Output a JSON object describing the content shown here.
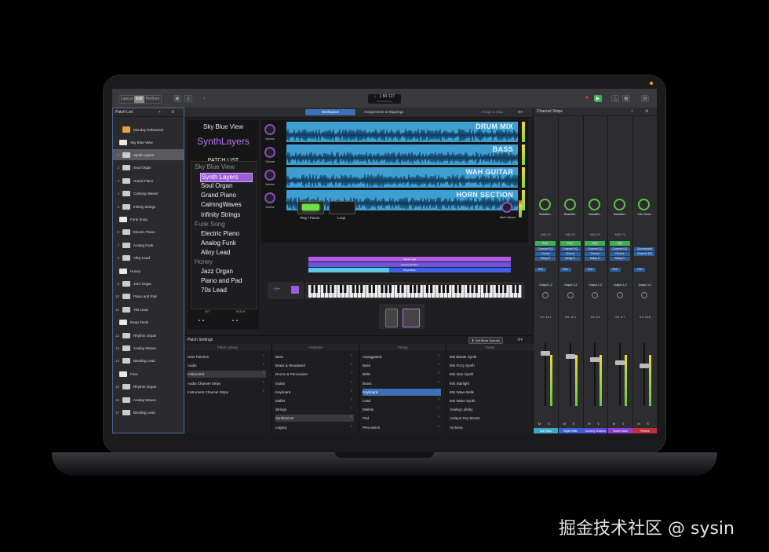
{
  "colors": {
    "accent": "#3c6fb8",
    "purple": "#9c5dd8",
    "green": "#6ee04a"
  },
  "toolbar": {
    "modes": [
      "Layout",
      "Edit",
      "Perform"
    ],
    "active_mode": "Edit",
    "lcd_line1": "♩ 1   84   127",
    "lcd_line2": "bar  tempo  key"
  },
  "patch_list": {
    "title": "Patch List",
    "concert": "Monday Rehearsal",
    "rows": [
      {
        "type": "folder",
        "label": "Sky Blue View"
      },
      {
        "type": "patch",
        "num": "1",
        "label": "Synth Layers",
        "selected": true
      },
      {
        "type": "patch",
        "num": "2",
        "label": "Soul Organ"
      },
      {
        "type": "patch",
        "num": "3",
        "label": "Grand Piano"
      },
      {
        "type": "patch",
        "num": "4",
        "label": "Calming Waves"
      },
      {
        "type": "patch",
        "num": "5",
        "label": "Infinity Strings"
      },
      {
        "type": "folder",
        "label": "Funk Song"
      },
      {
        "type": "patch",
        "num": "6",
        "label": "Electric Piano"
      },
      {
        "type": "patch",
        "num": "7",
        "label": "Analog Funk"
      },
      {
        "type": "patch",
        "num": "8",
        "label": "Alloy Lead"
      },
      {
        "type": "folder",
        "label": "Honey"
      },
      {
        "type": "patch",
        "num": "9",
        "label": "Jazz Organ"
      },
      {
        "type": "patch",
        "num": "10",
        "label": "Piano and Pad"
      },
      {
        "type": "patch",
        "num": "11",
        "label": "70s Lead"
      },
      {
        "type": "folder",
        "label": "Deep Feels"
      },
      {
        "type": "patch",
        "num": "12",
        "label": "Rhythm Organ"
      },
      {
        "type": "patch",
        "num": "13",
        "label": "Analog Waves"
      },
      {
        "type": "patch",
        "num": "14",
        "label": "Bending Lead"
      },
      {
        "type": "folder",
        "label": "Flow"
      },
      {
        "type": "patch",
        "num": "15",
        "label": "Rhythm Organ"
      },
      {
        "type": "patch",
        "num": "16",
        "label": "Analog Waves"
      },
      {
        "type": "patch",
        "num": "17",
        "label": "Bending Lead"
      }
    ]
  },
  "workspace": {
    "tabs": [
      "Workspace",
      "Assignments & Mappings",
      "Assign & Map"
    ],
    "set_name": "Sky Blue View",
    "patch_name": "SynthLayers",
    "list_title": "PATCH LIST",
    "list": [
      {
        "t": "hdr",
        "label": "Sky Blue View"
      },
      {
        "t": "sel",
        "label": "Synth Layers"
      },
      {
        "t": "itm",
        "label": "Soul Organ"
      },
      {
        "t": "itm",
        "label": "Grand Piano"
      },
      {
        "t": "itm",
        "label": "CalmngWaves"
      },
      {
        "t": "itm",
        "label": "Infinity Strings"
      },
      {
        "t": "hdr",
        "label": "Funk Song"
      },
      {
        "t": "itm",
        "label": "Electric Piano"
      },
      {
        "t": "itm",
        "label": "Analog Funk"
      },
      {
        "t": "itm",
        "label": "Alloy Lead"
      },
      {
        "t": "hdr",
        "label": "Honey"
      },
      {
        "t": "itm",
        "label": "Jazz Organ"
      },
      {
        "t": "itm",
        "label": "Piano and Pad"
      },
      {
        "t": "itm",
        "label": "70s Lead"
      }
    ],
    "set_label": "SET",
    "patch_label": "PATCH",
    "knob_label": "Volume",
    "tracks": [
      "DRUM MIX",
      "BASS",
      "WAH GUITAR",
      "HORN SECTION"
    ],
    "play_label": "Play / Pause",
    "loop_label": "Loop",
    "main_volume": "Main Volume",
    "layers": [
      "Sweet Lead",
      "Glowing Shadow",
      "Bright Bells"
    ]
  },
  "channel_strips": {
    "title": "Channel Strips",
    "strips": [
      {
        "setting": "Beautiful...",
        "input": "MIDI FX",
        "eq": "EQ2",
        "fx": [
          "Channel EQ",
          "Chorus",
          "Delay D"
        ],
        "send": "Rvb",
        "output": "Output 1-2",
        "vals": "0.0  -12.1",
        "name": "Sub Bass",
        "color": "#3ba7c9"
      },
      {
        "setting": "Beautiful...",
        "input": "MIDI FX",
        "eq": "EQ2",
        "fx": [
          "Channel EQ",
          "Chorus",
          "Delay D"
        ],
        "send": "Rvb",
        "output": "Output 1-2",
        "vals": "0.0  -12.1",
        "name": "Bright Bells",
        "color": "#3b5fd6"
      },
      {
        "setting": "Beautiful...",
        "input": "MIDI FX",
        "eq": "EQ2",
        "fx": [
          "Channel EQ",
          "Chorus",
          "Delay D"
        ],
        "send": "Rvb",
        "output": "Output 1-2",
        "vals": "0.0  -3.4",
        "name": "Glowing Shadow",
        "color": "#5a48d8"
      },
      {
        "setting": "Beautiful...",
        "input": "MIDI FX",
        "eq": "EQ2",
        "fx": [
          "Channel EQ",
          "Chorus",
          "Delay D"
        ],
        "send": "Rvb",
        "output": "Output 1-2",
        "vals": "0.0  -9.7",
        "name": "Sweet Lead",
        "color": "#8a3fd0"
      },
      {
        "setting": "1-Bz Vocal...",
        "input": "",
        "eq": "",
        "fx": [
          "Chromaverb",
          "Channel EQ"
        ],
        "send": "Rvb",
        "output": "Output 1-2",
        "vals": "0.0  -12.6",
        "name": "Reverb",
        "color": "#c0303a"
      }
    ],
    "m": "M",
    "s": "S"
  },
  "patch_settings": {
    "title": "Patch Settings",
    "get_more": "Get More Sounds",
    "library_header": "Patch Library",
    "col_headers": [
      "Attributes",
      "Timing",
      "Tones"
    ],
    "col1": [
      "User Patches",
      "Audio",
      "Instrument",
      "Audio Channel Strips",
      "Instrument Channel Strips"
    ],
    "col2": [
      "Bass",
      "Brass & Woodwind",
      "Drums & Percussion",
      "Guitar",
      "Keyboard",
      "Mallet",
      "Strings",
      "Synthesizer",
      "Legacy"
    ],
    "col3": [
      "Arpeggiated",
      "Bass",
      "Bells",
      "Brass",
      "Keyboard",
      "Lead",
      "Mallets",
      "Pad",
      "Percussion"
    ],
    "col4": [
      "80s Bitrate Synth",
      "80s Fizzy Synth",
      "80s Sine Synth",
      "80s Starlight",
      "80s Wave Bells",
      "80s Wave Synth",
      "Analog Lullaby",
      "Antique Key Moves",
      "Arcturus"
    ]
  },
  "watermark": "掘金技术社区 @ sysin"
}
